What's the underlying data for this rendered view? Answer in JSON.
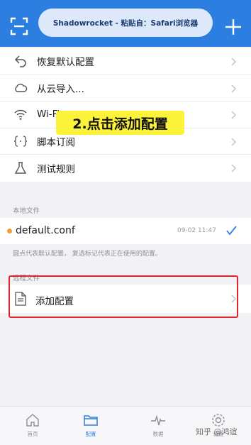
{
  "header": {
    "paste_banner": "Shadowrocket - 粘贴自：Safari浏览器",
    "colors": {
      "header_bg": "#2c7ee0",
      "banner_bg": "#dde9fb"
    },
    "icons": [
      "scan-icon",
      "plus-icon"
    ]
  },
  "menu": {
    "items": [
      {
        "label": "恢复默认配置",
        "icon": "restore-icon"
      },
      {
        "label": "从云导入...",
        "icon": "cloud-icon"
      },
      {
        "label": "Wi-Fi",
        "icon": "wifi-icon"
      },
      {
        "label": "脚本订阅",
        "icon": "script-icon"
      },
      {
        "label": "测试规则",
        "icon": "test-rule-icon"
      }
    ]
  },
  "annotation": {
    "text": "2.点击添加配置",
    "color": "#fbf23a"
  },
  "local": {
    "title": "本地文件",
    "file_name": "default.conf",
    "file_date": "09-02 11:47",
    "hint": "圆点代表默认配置， 复选标记代表正在使用的配置。"
  },
  "remote": {
    "title": "远程文件",
    "add_label": "添加配置",
    "highlight_color": "#e0242c"
  },
  "tabbar": {
    "tabs": [
      {
        "label": "首页",
        "icon": "home-icon",
        "active": false
      },
      {
        "label": "配置",
        "icon": "folder-icon",
        "active": true
      },
      {
        "label": "数据",
        "icon": "pulse-icon",
        "active": false
      },
      {
        "label": "设置",
        "icon": "gear-icon",
        "active": false
      }
    ]
  },
  "watermark": "知乎 @鸿谊"
}
